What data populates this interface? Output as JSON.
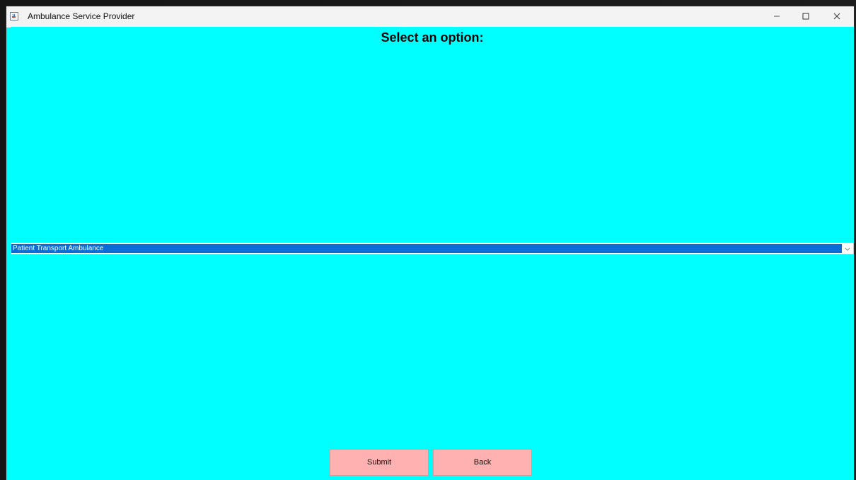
{
  "window": {
    "title": "Ambulance Service Provider",
    "icon": "java-cup-icon",
    "controls": {
      "minimize_icon": "minimize-icon",
      "maximize_icon": "maximize-icon",
      "close_icon": "close-icon"
    }
  },
  "main": {
    "heading": "Select an option:",
    "background_color": "#00ffff",
    "dropdown": {
      "selected_value": "Patient Transport Ambulance",
      "arrow_icon": "chevron-down-icon",
      "selection_color": "#0b6cd6"
    }
  },
  "actions": {
    "submit_label": "Submit",
    "back_label": "Back",
    "button_color": "#ffb0b0"
  }
}
